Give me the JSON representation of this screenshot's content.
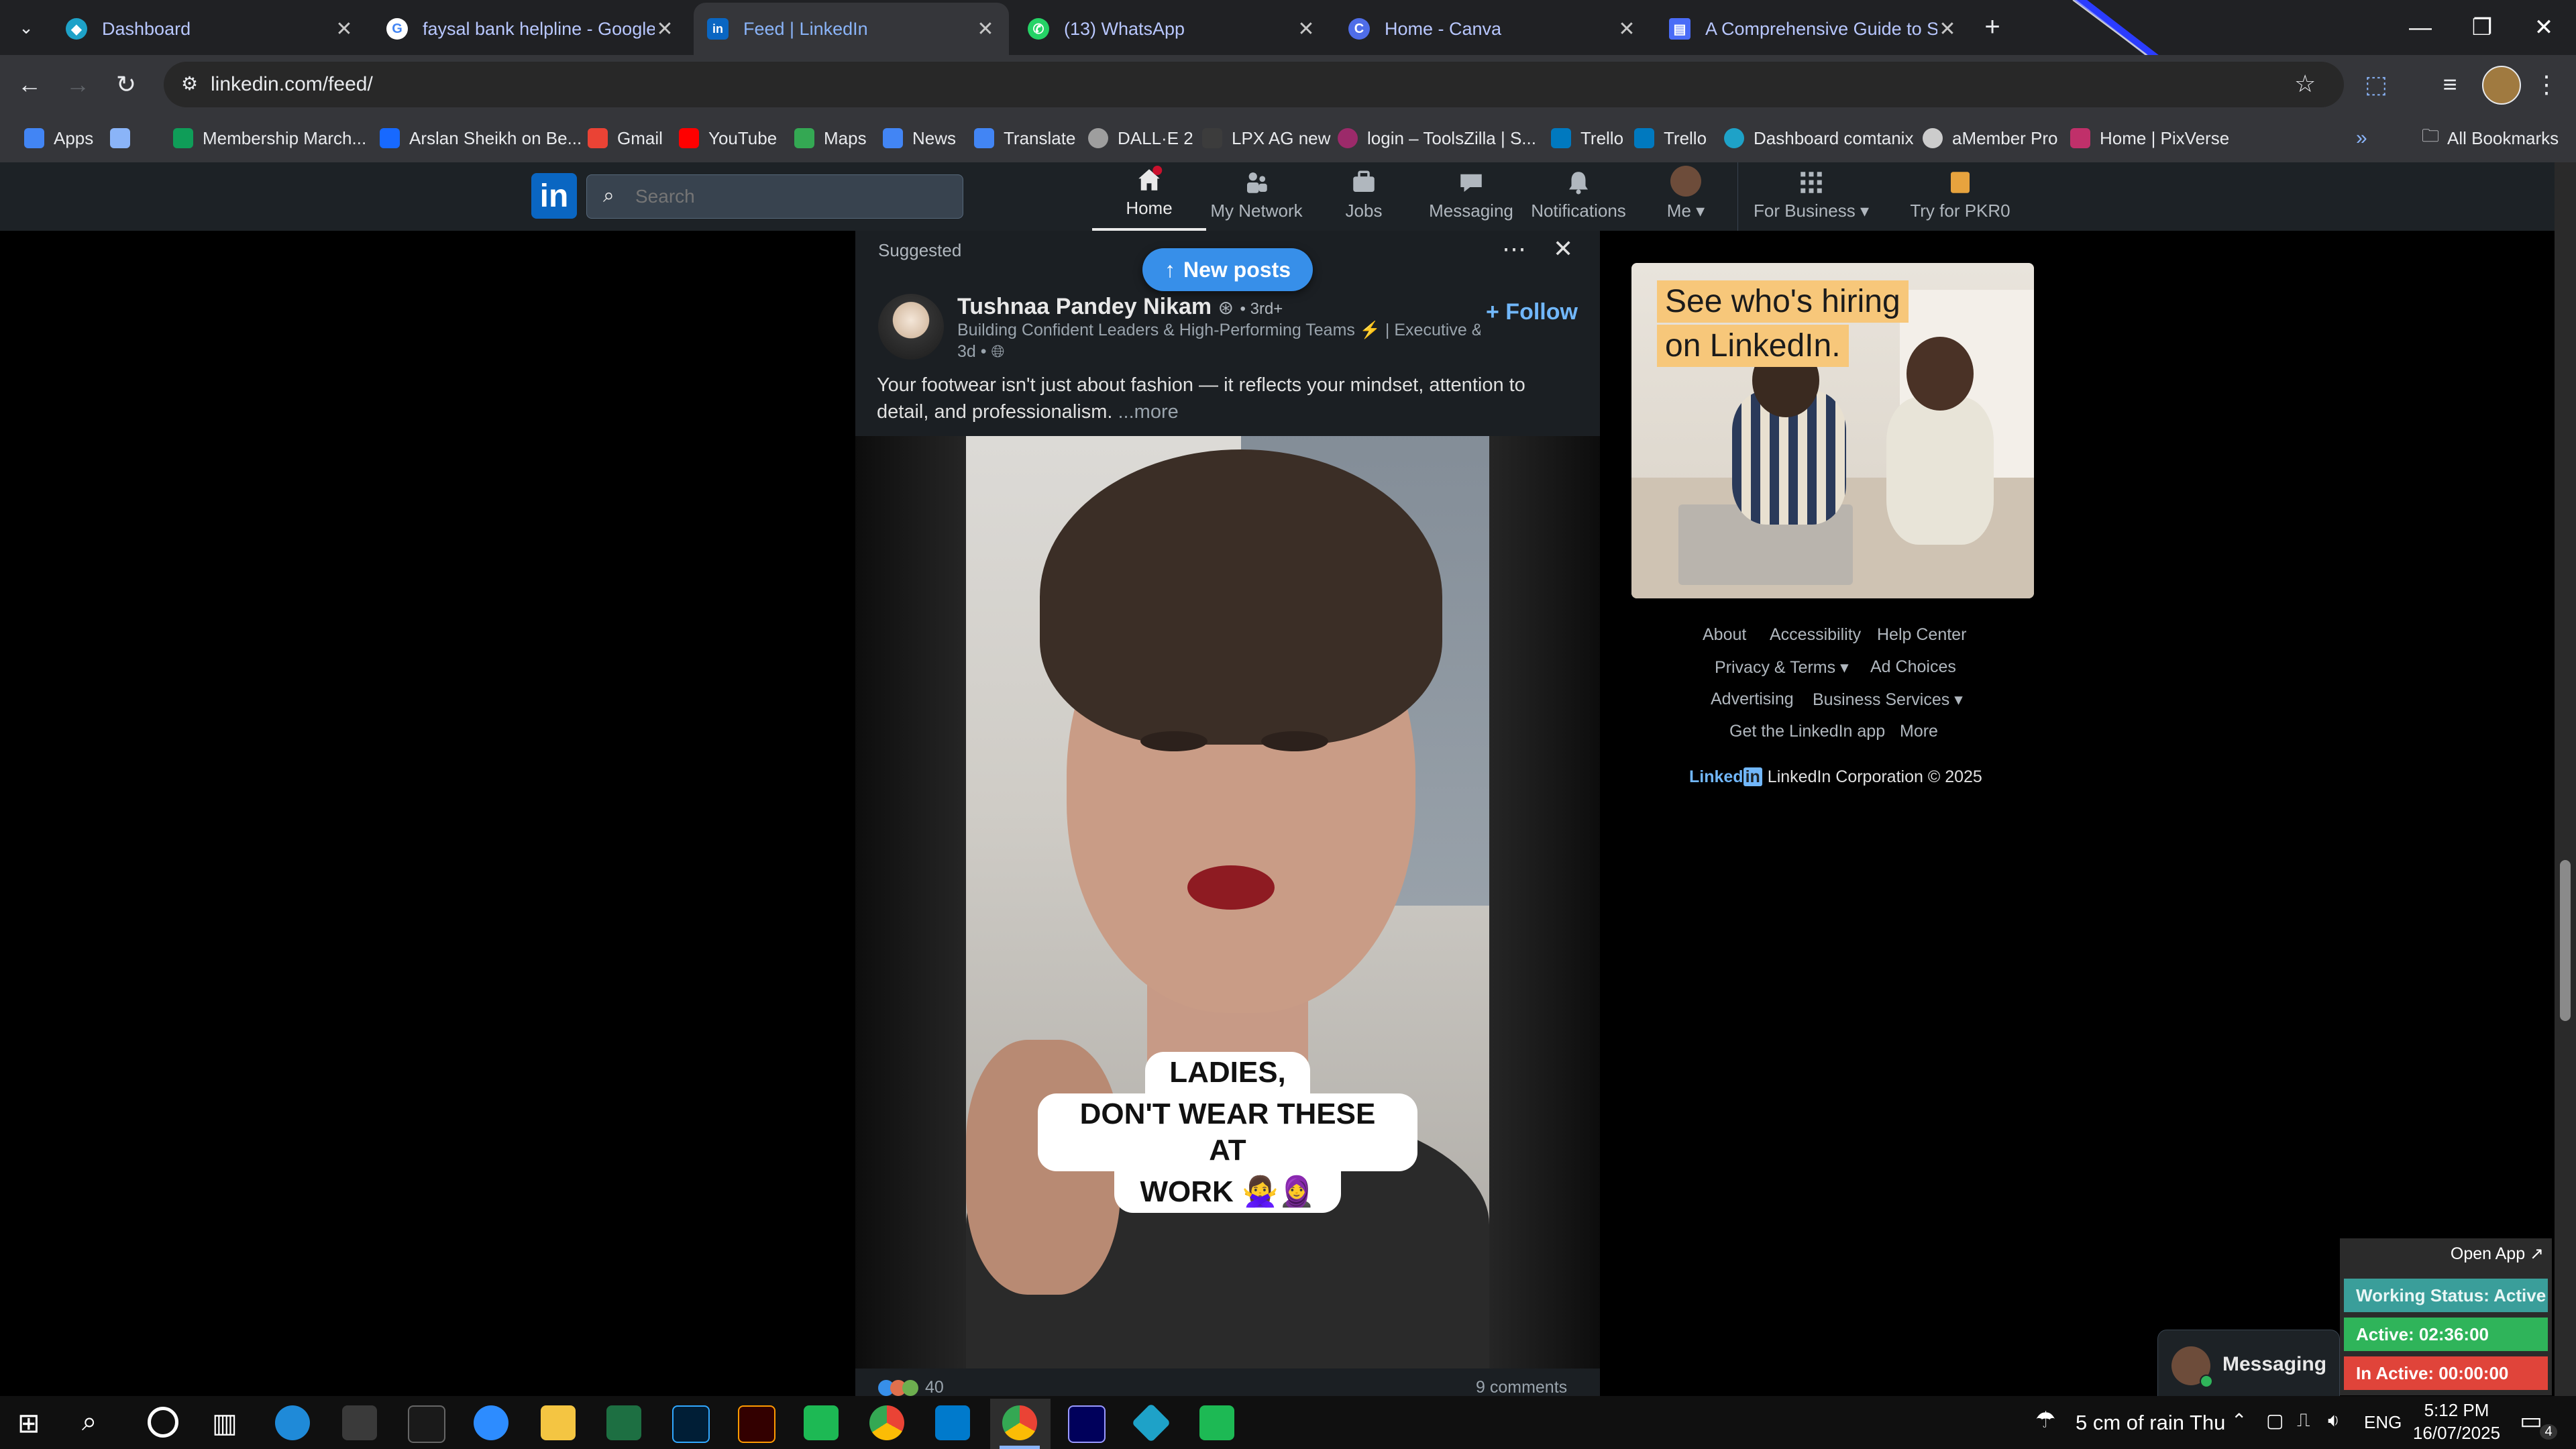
{
  "browser": {
    "tabs": [
      {
        "title": "Dashboard",
        "favicon": "dashboard-favicon",
        "color": "#1ea2c8",
        "glyph": ""
      },
      {
        "title": "faysal bank helpline - Google S",
        "favicon": "google-favicon",
        "color": "#ffffff",
        "glyph": "G"
      },
      {
        "title": "Feed | LinkedIn",
        "favicon": "linkedin-favicon",
        "color": "#0a66c2",
        "glyph": "in"
      },
      {
        "title": "(13) WhatsApp",
        "favicon": "whatsapp-favicon",
        "color": "#25d366",
        "glyph": ""
      },
      {
        "title": "Home - Canva",
        "favicon": "canva-favicon",
        "color": "#4f6de8",
        "glyph": "C"
      },
      {
        "title": "A Comprehensive Guide to Stra",
        "favicon": "docs-favicon",
        "color": "#4a6cf7",
        "glyph": ""
      }
    ],
    "url": "linkedin.com/feed/",
    "bookmarks": [
      {
        "label": "Apps",
        "color": "#4285f4"
      },
      {
        "label": "",
        "color": "#8ab4f8"
      },
      {
        "label": "Membership March...",
        "color": "#0f9d58"
      },
      {
        "label": "Arslan Sheikh on Be...",
        "color": "#1769ff"
      },
      {
        "label": "Gmail",
        "color": "#ea4335"
      },
      {
        "label": "YouTube",
        "color": "#ff0000"
      },
      {
        "label": "Maps",
        "color": "#34a853"
      },
      {
        "label": "News",
        "color": "#4285f4"
      },
      {
        "label": "Translate",
        "color": "#4285f4"
      },
      {
        "label": "DALL·E 2",
        "color": "#9e9e9e"
      },
      {
        "label": "LPX AG new",
        "color": "#3c3c3c"
      },
      {
        "label": "login – ToolsZilla | S...",
        "color": "#9c2a6a"
      },
      {
        "label": "Trello",
        "color": "#0079bf"
      },
      {
        "label": "Trello",
        "color": "#0079bf"
      },
      {
        "label": "Dashboard comtanix",
        "color": "#1ea2c8"
      },
      {
        "label": "aMember Pro",
        "color": "#cccccc"
      },
      {
        "label": "Home | PixVerse",
        "color": "#c0306a"
      }
    ],
    "all_bookmarks": "All Bookmarks"
  },
  "linkedin_nav": {
    "search_placeholder": "Search",
    "items": [
      {
        "label": "Home",
        "icon": "home-icon"
      },
      {
        "label": "My Network",
        "icon": "network-icon"
      },
      {
        "label": "Jobs",
        "icon": "jobs-icon"
      },
      {
        "label": "Messaging",
        "icon": "messaging-icon"
      },
      {
        "label": "Notifications",
        "icon": "bell-icon"
      },
      {
        "label": "Me",
        "icon": "avatar-icon"
      },
      {
        "label": "For Business",
        "icon": "grid-icon"
      },
      {
        "label": "Try for PKR0",
        "icon": "premium-icon"
      }
    ]
  },
  "post": {
    "suggested_label": "Suggested",
    "new_posts_label": "New posts",
    "author_name": "Tushnaa Pandey Nikam",
    "degree": "• 3rd+",
    "headline": "Building Confident Leaders & High-Performing Teams ⚡ | Executive & ...",
    "time": "3d •",
    "follow_label": "+ Follow",
    "text": "Your footwear isn't just about fashion — it reflects your mindset, attention to detail, and professionalism.",
    "more_label": "...more",
    "video_caption_lines": [
      "LADIES,",
      "DON'T WEAR THESE AT",
      "WORK 🙅‍♀️🧕"
    ],
    "reaction_count": "40",
    "comments": "9 comments"
  },
  "ad": {
    "line1": "See who's hiring",
    "line2": "on LinkedIn."
  },
  "footer": {
    "links": [
      "About",
      "Accessibility",
      "Help Center",
      "Privacy & Terms ▾",
      "Ad Choices",
      "Advertising",
      "Business Services ▾",
      "Get the LinkedIn app",
      "More"
    ],
    "brand": "Linked",
    "brand_in": "in",
    "copyright": "LinkedIn Corporation © 2025"
  },
  "messaging_widget": {
    "label": "Messaging"
  },
  "tracker_widget": {
    "open_app": "Open App ↗",
    "working_status": "Working Status: Active",
    "active": "Active: 02:36:00",
    "inactive": "In Active: 00:00:00"
  },
  "taskbar": {
    "weather": "5 cm of rain Thu",
    "lang": "ENG",
    "time": "5:12 PM",
    "date": "16/07/2025",
    "notif_count": "4"
  },
  "colors": {
    "linkedin_blue": "#0a66c2",
    "follow_blue": "#71b7fb",
    "working_teal": "#3a9e9a",
    "active_green": "#2fb45a",
    "inactive_red": "#e0443a"
  }
}
